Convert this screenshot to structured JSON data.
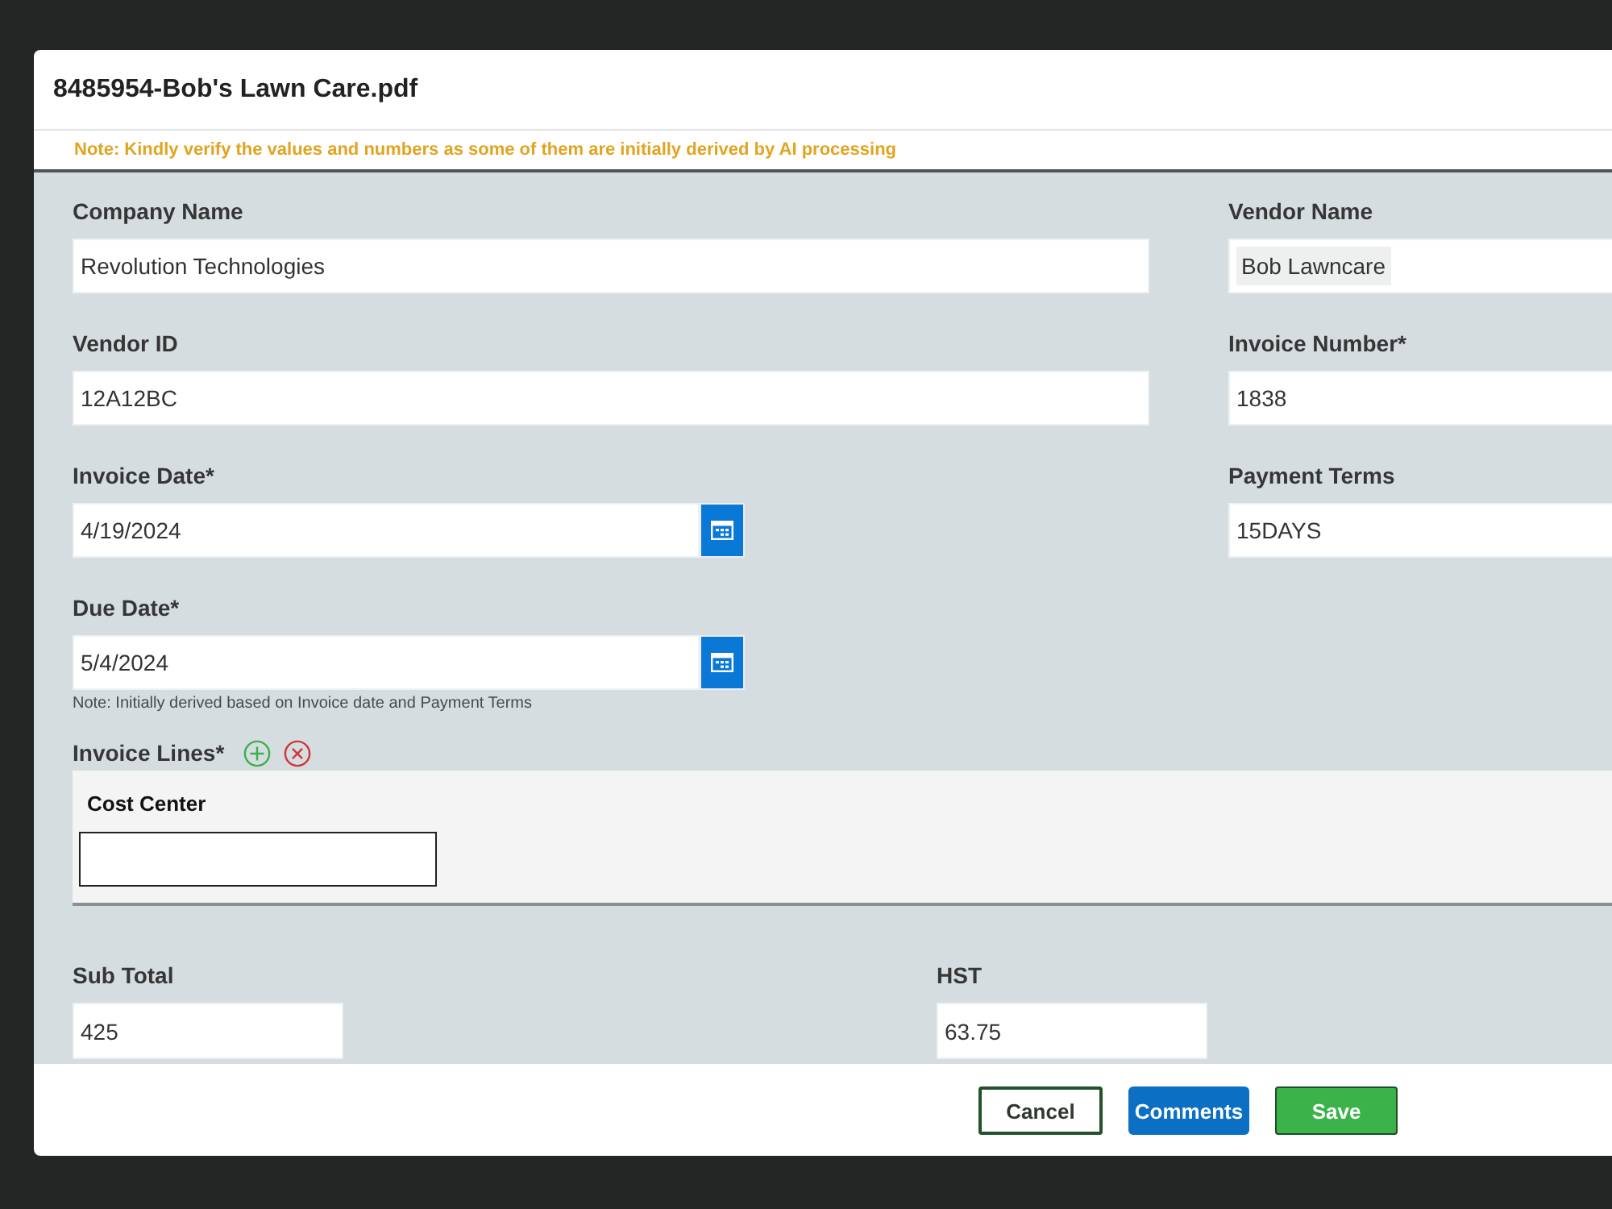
{
  "dialog": {
    "title": "8485954-Bob's Lawn Care.pdf",
    "notice": "Note: Kindly verify the values and numbers as some of them are initially derived by AI processing"
  },
  "rows": [
    [
      {
        "label": "Company Name",
        "value": "Revolution Technologies",
        "kind": "text",
        "highlighted": false
      },
      {
        "label": "Vendor Name",
        "value": "Bob Lawncare",
        "kind": "text",
        "highlighted": true
      }
    ],
    [
      {
        "label": "Vendor ID",
        "value": "12A12BC",
        "kind": "text",
        "highlighted": false
      },
      {
        "label": "Invoice Number*",
        "value": "1838",
        "kind": "text",
        "highlighted": false
      }
    ],
    [
      {
        "label": "Invoice Date*",
        "value": "4/19/2024",
        "kind": "date",
        "highlighted": false
      },
      {
        "label": "Payment Terms",
        "value": "15DAYS",
        "kind": "text",
        "highlighted": false
      }
    ],
    [
      {
        "label": "Due Date*",
        "value": "5/4/2024",
        "kind": "date",
        "highlighted": false,
        "note": "Note: Initially derived based on Invoice date and Payment Terms"
      }
    ]
  ],
  "invoice_lines": {
    "label": "Invoice Lines*",
    "columns": [
      {
        "header": "Cost Center"
      }
    ]
  },
  "totals": [
    {
      "label": "Sub Total",
      "value": "425"
    },
    {
      "label": "HST",
      "value": "63.75"
    }
  ],
  "buttons": [
    {
      "label": "Cancel",
      "kind": "secondary"
    },
    {
      "label": "Comments",
      "kind": "info"
    },
    {
      "label": "Save",
      "kind": "primary"
    }
  ]
}
